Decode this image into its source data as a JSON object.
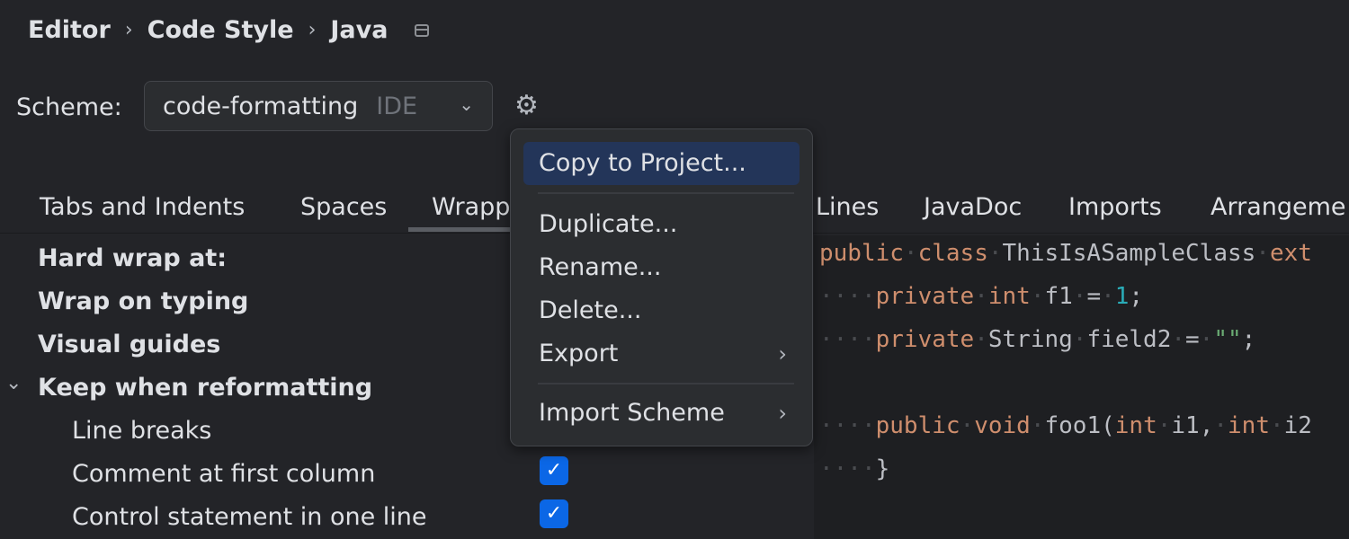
{
  "breadcrumb": {
    "items": [
      "Editor",
      "Code Style",
      "Java"
    ],
    "icon": "window-icon"
  },
  "scheme": {
    "label": "Scheme:",
    "value": "code-formatting",
    "badge": "IDE",
    "settings_icon": "gear-icon"
  },
  "tabs": [
    {
      "label": "Tabs and Indents"
    },
    {
      "label": "Spaces"
    },
    {
      "label": "Wrapp",
      "active": true
    },
    {
      "label": "Lines"
    },
    {
      "label": "JavaDoc"
    },
    {
      "label": "Imports"
    },
    {
      "label": "Arrangeme"
    }
  ],
  "options": [
    {
      "label": "Hard wrap at:",
      "bold": true
    },
    {
      "label": "Wrap on typing",
      "bold": true
    },
    {
      "label": "Visual guides",
      "bold": true
    },
    {
      "label": "Keep when reformatting",
      "bold": true,
      "expanded": true
    },
    {
      "label": "Line breaks"
    },
    {
      "label": "Comment at first column",
      "checked": true
    },
    {
      "label": "Control statement in one line",
      "checked": true
    }
  ],
  "menu": {
    "items": [
      {
        "label": "Copy to Project...",
        "selected": true
      },
      {
        "label": "Duplicate..."
      },
      {
        "label": "Rename..."
      },
      {
        "label": "Delete..."
      },
      {
        "label": "Export",
        "submenu": true
      },
      {
        "label": "Import Scheme",
        "submenu": true
      }
    ]
  },
  "code": {
    "lines": [
      "public class ThisIsASampleClass ext",
      "private int f1 = 1;",
      "private String field2 = \"\";",
      "",
      "public void foo1(int i1, int i2",
      "}"
    ]
  },
  "colors": {
    "accent": "#0b67e6",
    "selection": "#233559",
    "keyword": "#cf8e6d",
    "number": "#2aacb8",
    "string": "#6aab73"
  }
}
